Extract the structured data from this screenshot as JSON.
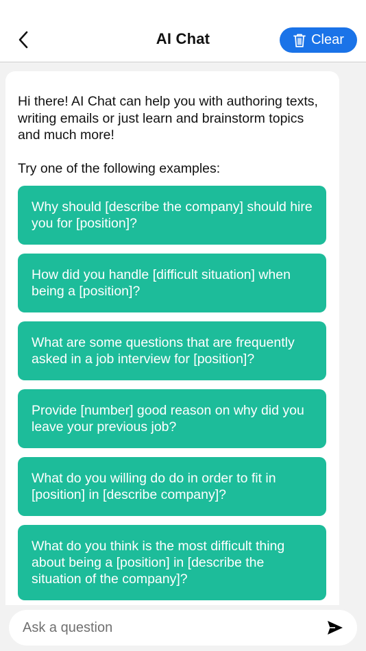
{
  "header": {
    "title": "AI Chat",
    "clear_label": "Clear",
    "back_icon": "chevron-left-icon",
    "clear_icon": "trash-icon"
  },
  "chat": {
    "intro": "Hi there! AI Chat can help you with authoring texts, writing emails or just learn and brainstorm topics and much more!",
    "try_label": "Try one of the following examples:",
    "examples": [
      "Why should [describe the company] should hire you for [position]?",
      "How did you handle [difficult situation] when being a [position]?",
      "What are some questions that are frequently asked in a job interview for [position]?",
      "Provide [number] good reason on why did you leave your previous job?",
      "What do you willing do do in order to fit in [position] in [describe company]?",
      "What do you think is the most difficult thing about being a [position] in [describe the situation of the company]?"
    ]
  },
  "input": {
    "placeholder": "Ask a question",
    "send_icon": "send-icon"
  },
  "colors": {
    "accent_blue": "#1a73e8",
    "example_green": "#1dbc9a",
    "background": "#f2f2f2"
  }
}
